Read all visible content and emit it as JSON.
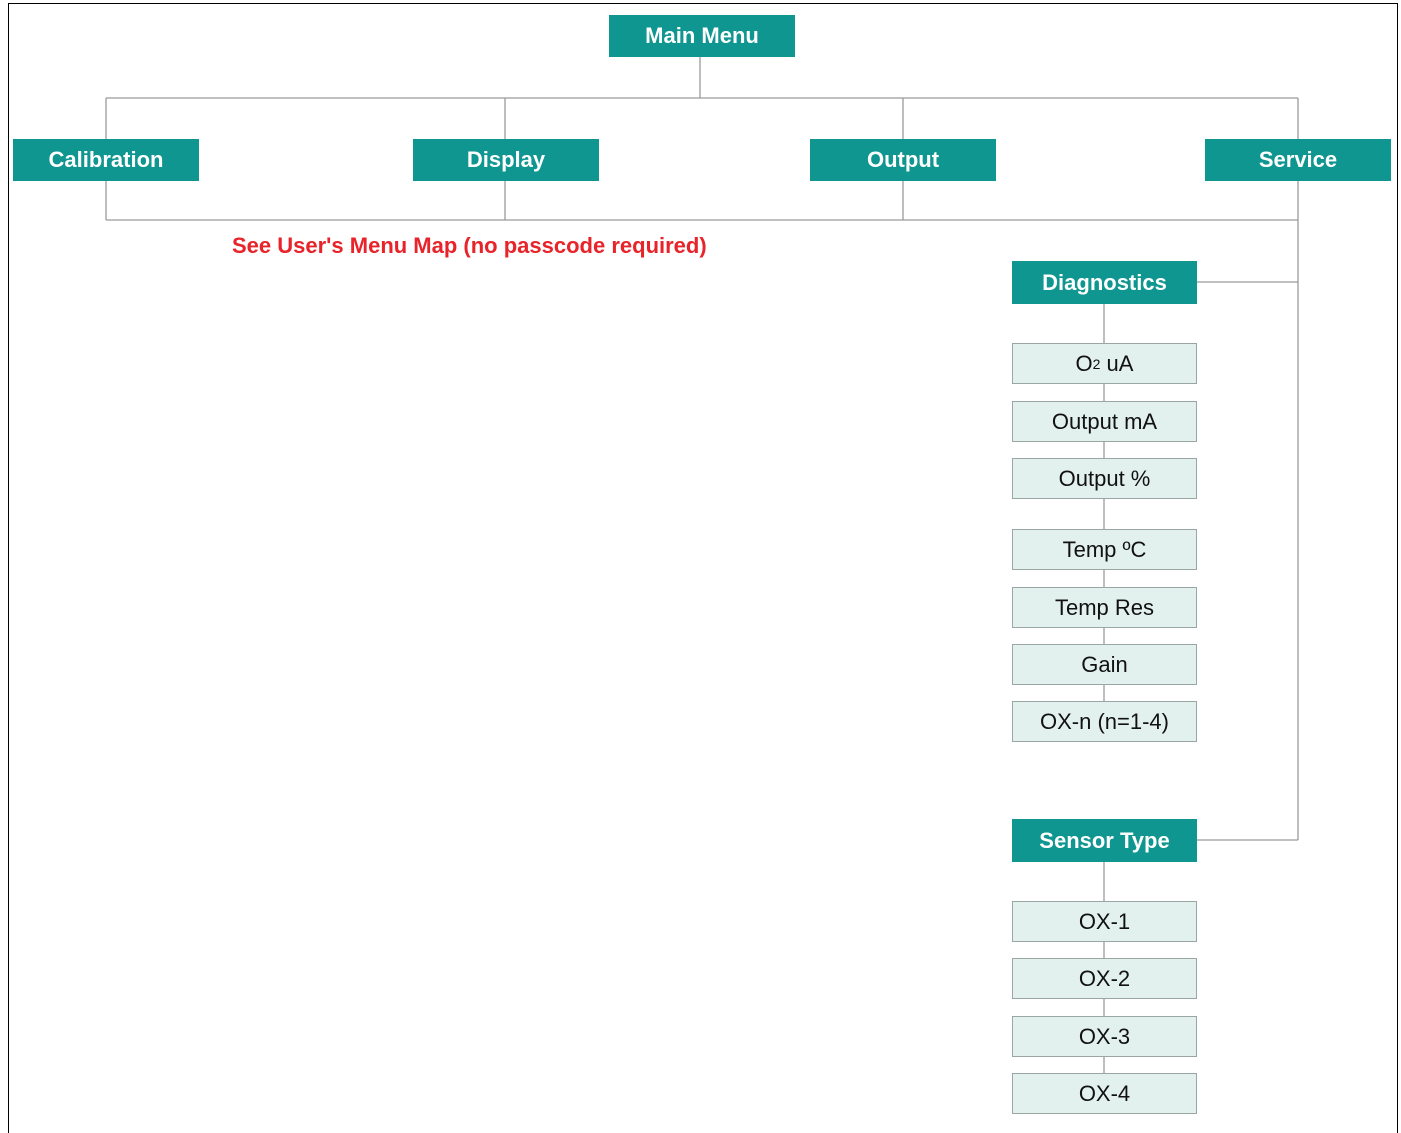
{
  "main_menu": "Main Menu",
  "top_items": [
    "Calibration",
    "Display",
    "Output",
    "Service"
  ],
  "note": "See User's Menu Map (no passcode required)",
  "diagnostics": {
    "title": "Diagnostics",
    "o2_prefix": "O",
    "o2_subscript": "2",
    "o2_suffix": " uA",
    "items": [
      "Output mA",
      "Output %",
      "Temp ºC",
      "Temp Res",
      "Gain",
      "OX-n (n=1-4)"
    ]
  },
  "sensor_type": {
    "title": "Sensor Type",
    "items": [
      "OX-1",
      "OX-2",
      "OX-3",
      "OX-4"
    ]
  },
  "colors": {
    "teal": "#0f9690",
    "sub_fill": "#e3f1ee",
    "note_red": "#e8232a",
    "connector": "#9a9a9a"
  }
}
